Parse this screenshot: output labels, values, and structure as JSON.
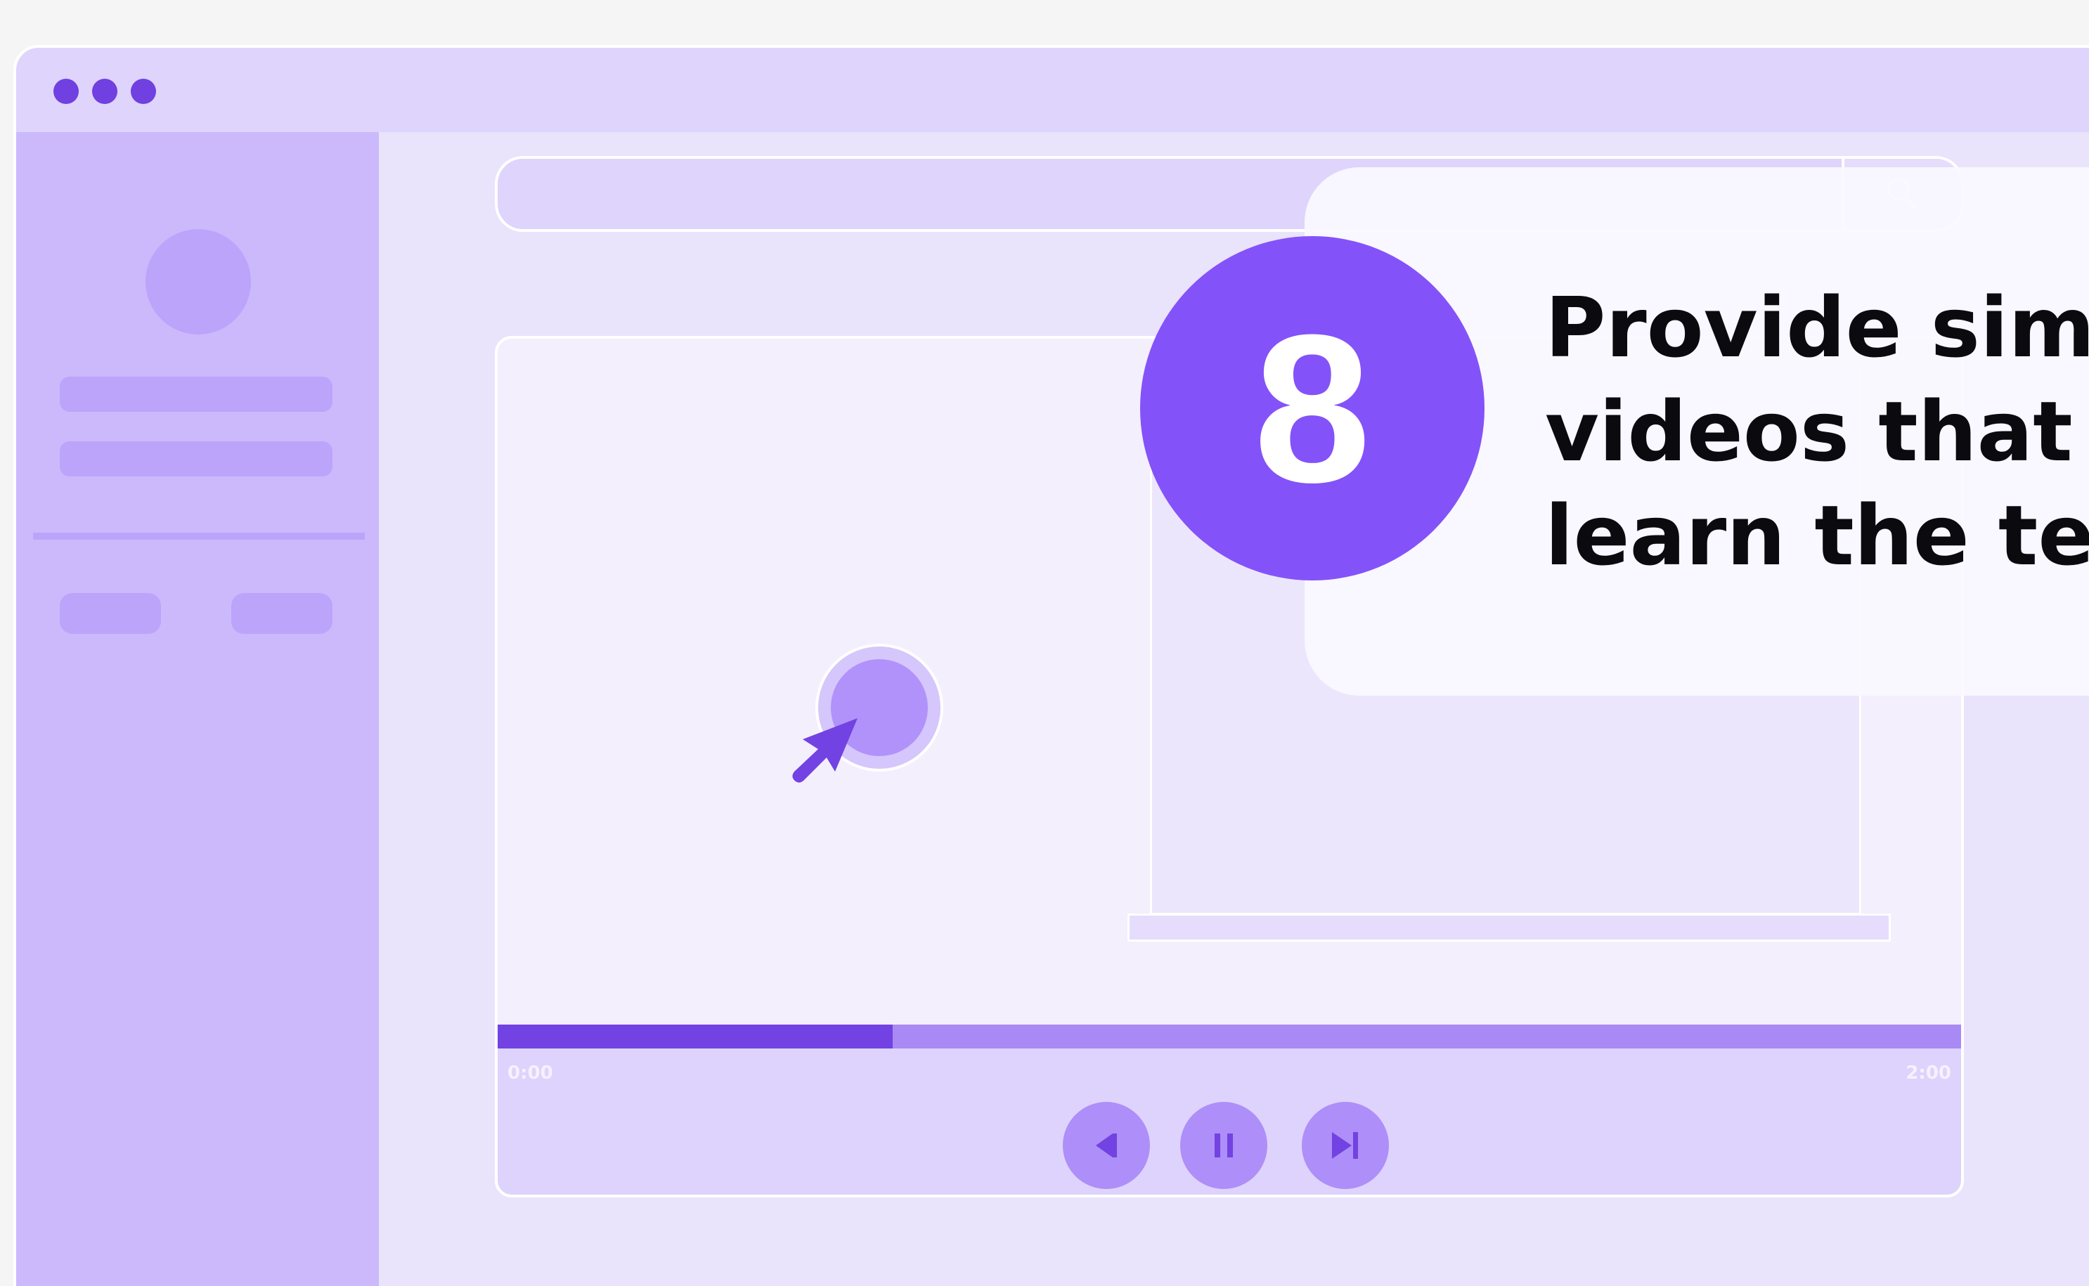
{
  "window": {
    "traffic_lights": [
      "window-dot",
      "window-dot",
      "window-dot"
    ]
  },
  "search": {
    "icon": "search-icon"
  },
  "player": {
    "time_start": "0:00",
    "time_end": "2:00",
    "progress_fraction": 0.27,
    "controls": {
      "prev_icon": "skip-back-icon",
      "pause_icon": "pause-icon",
      "next_icon": "skip-forward-icon"
    }
  },
  "callout": {
    "number": "8",
    "headline": "Provide simp\nvideos that h\nlearn the tec"
  },
  "colors": {
    "accent": "#7242e2",
    "badge": "#8452f9",
    "sidebar": "#cbb9fc",
    "background": "#e9e3fb"
  }
}
